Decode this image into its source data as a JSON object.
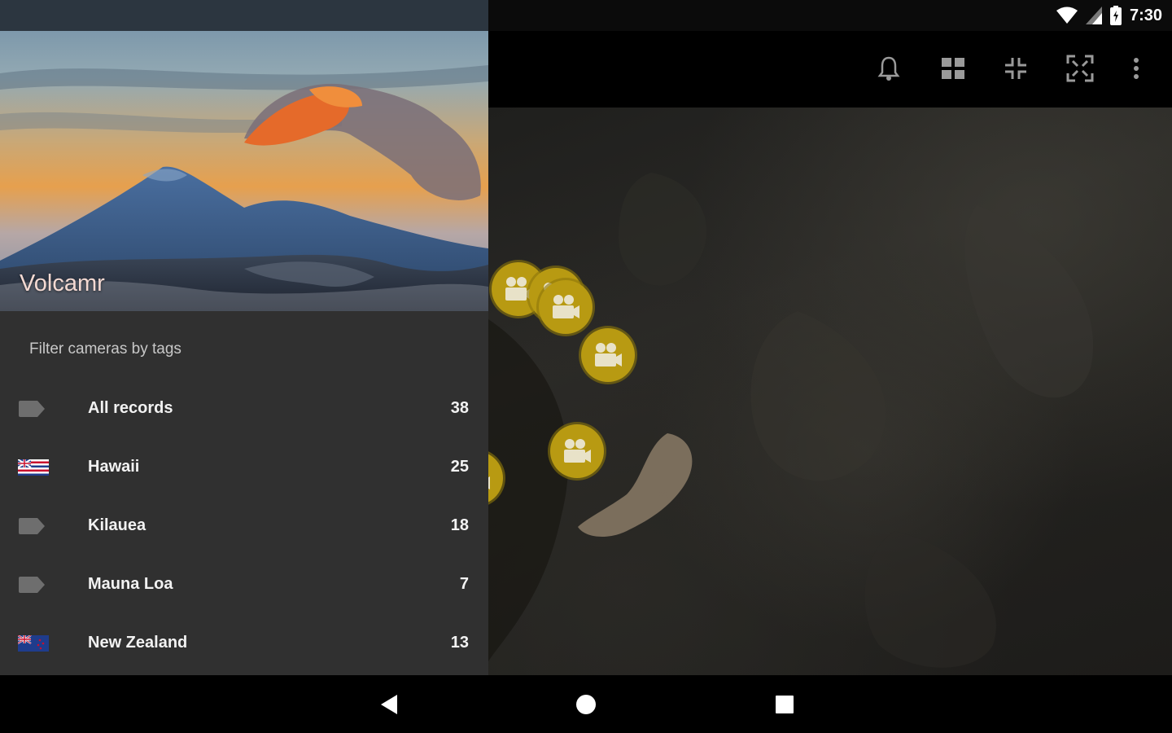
{
  "status_bar": {
    "time": "7:30"
  },
  "drawer": {
    "app_title": "Volcamr",
    "filter_header": "Filter cameras by tags",
    "tags": [
      {
        "label": "All records",
        "count": "38",
        "icon": "tag-icon"
      },
      {
        "label": "Hawaii",
        "count": "25",
        "icon": "hawaii-flag-icon"
      },
      {
        "label": "Kilauea",
        "count": "18",
        "icon": "tag-icon"
      },
      {
        "label": "Mauna Loa",
        "count": "7",
        "icon": "tag-icon"
      },
      {
        "label": "New Zealand",
        "count": "13",
        "icon": "new-zealand-flag-icon"
      }
    ]
  },
  "toolbar": {
    "actions": [
      "bell-icon",
      "grid-icon",
      "collapse-icon",
      "expand-icon",
      "more-vert-icon"
    ]
  },
  "map": {
    "marker_icon": "camera-icon",
    "marker_color": "#b89a12"
  },
  "nav_bar": {
    "buttons": [
      "back-icon",
      "home-icon",
      "recents-icon"
    ]
  },
  "colors": {
    "drawer_bg": "#303030",
    "title_color": "#f3d9d2",
    "marker": "#b89a12"
  }
}
